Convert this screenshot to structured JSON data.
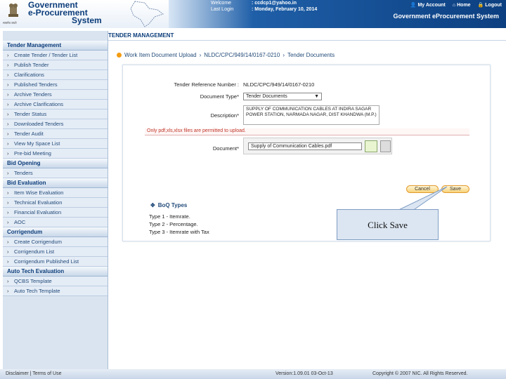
{
  "header": {
    "brand_line1": "Government",
    "brand_line2": "e-Procurement",
    "brand_line3": "System",
    "emblem_caption": "सत्यमेव जयते",
    "welcome_label": "Welcome",
    "welcome_value": ": ccdcp1@yahoo.in",
    "last_login_label": "Last Login",
    "last_login_value": ": Monday, February 10, 2014",
    "my_account": "My Account",
    "home": "Home",
    "logout": "Logout",
    "system_name": "Government eProcurement System"
  },
  "sidebar": {
    "title": "TENDER MANAGEMENT",
    "sections": [
      {
        "title": "Tender Management",
        "items": [
          "Create Tender / Tender List",
          "Publish Tender",
          "Clarifications",
          "Published Tenders",
          "Archive Tenders",
          "Archive Clarifications",
          "Tender Status",
          "Downloaded Tenders",
          "Tender Audit",
          "View My Space List",
          "Pre-bid Meeting"
        ]
      },
      {
        "title": "Bid Opening",
        "items": [
          "Tenders"
        ]
      },
      {
        "title": "Bid Evaluation",
        "items": [
          "Item Wise Evaluation",
          "Technical Evaluation",
          "Financial Evaluation",
          "AOC"
        ]
      },
      {
        "title": "Corrigendum",
        "items": [
          "Create Corrigendum",
          "Corrigendum List",
          "Corrigendum Published List"
        ]
      },
      {
        "title": "Auto Tech Evaluation",
        "items": [
          "QCBS Template",
          "Auto Tech Template"
        ]
      }
    ]
  },
  "breadcrumb": {
    "page": "Work Item Document Upload",
    "ref": "NLDC/CPC/949/14/0167-0210",
    "section": "Tender Documents"
  },
  "form": {
    "tender_ref_label": "Tender Reference Number :",
    "tender_ref_value": "NLDC/CPC/949/14/0167-0210",
    "doc_type_label": "Document Type*",
    "doc_type_value": "Tender Documents",
    "description_label": "Description*",
    "description_value": "SUPPLY OF COMMUNICATION CABLES AT INDIRA SAGAR POWER STATION, NARMADA NAGAR, DIST KHANDWA (M.P.)",
    "warning": "Only pdf,xls,xlsx files are permitted to upload.",
    "document_label": "Document*",
    "document_value": "Supply of Communication Cables.pdf",
    "cancel_label": "Cancel",
    "save_label": "Save"
  },
  "boq": {
    "title": "BoQ Types",
    "lines": [
      "Type 1 - Itemrate.",
      "Type 2 - Percentage.",
      "Type 3 - Itemrate with Tax"
    ]
  },
  "callout": {
    "text": "Click Save"
  },
  "footer": {
    "links": "Disclaimer  |  Terms of Use",
    "version": "Version:1.09.01 03-Oct-13",
    "copyright": "Copyright © 2007 NIC. All Rights Reserved."
  },
  "colors": {
    "brand": "#0b3c7a",
    "header_dark": "#0c3f80",
    "warning": "#c0392b",
    "button": "#f8d37a"
  }
}
